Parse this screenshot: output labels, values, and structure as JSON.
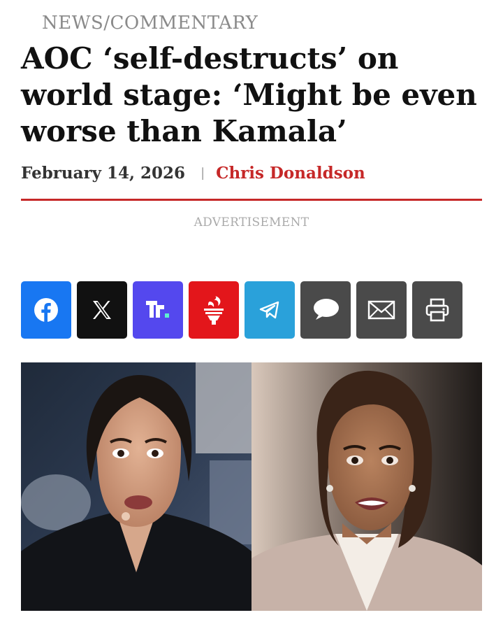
{
  "article": {
    "category": "NEWS/COMMENTARY",
    "headline": "AOC ‘self-destructs’ on world stage: ‘Might be even worse than Kamala’",
    "date": "February 14, 2026",
    "separator": "|",
    "author": "Chris Donaldson"
  },
  "ad": {
    "label": "ADVERTISEMENT"
  },
  "share_buttons": [
    {
      "name": "facebook",
      "icon": "facebook-icon",
      "color": "#1877f2"
    },
    {
      "name": "x",
      "icon": "x-icon",
      "color": "#111111"
    },
    {
      "name": "truth-social",
      "icon": "truth-social-icon",
      "color": "#5448ee"
    },
    {
      "name": "gettr",
      "icon": "gettr-icon",
      "color": "#e3161b"
    },
    {
      "name": "telegram",
      "icon": "telegram-icon",
      "color": "#2aa1da"
    },
    {
      "name": "sms",
      "icon": "speech-bubble-icon",
      "color": "#4a4a4a"
    },
    {
      "name": "email",
      "icon": "envelope-icon",
      "color": "#4a4a4a"
    },
    {
      "name": "print",
      "icon": "printer-icon",
      "color": "#4a4a4a"
    }
  ],
  "colors": {
    "accent": "#c62828",
    "muted": "#8a8a8a"
  }
}
